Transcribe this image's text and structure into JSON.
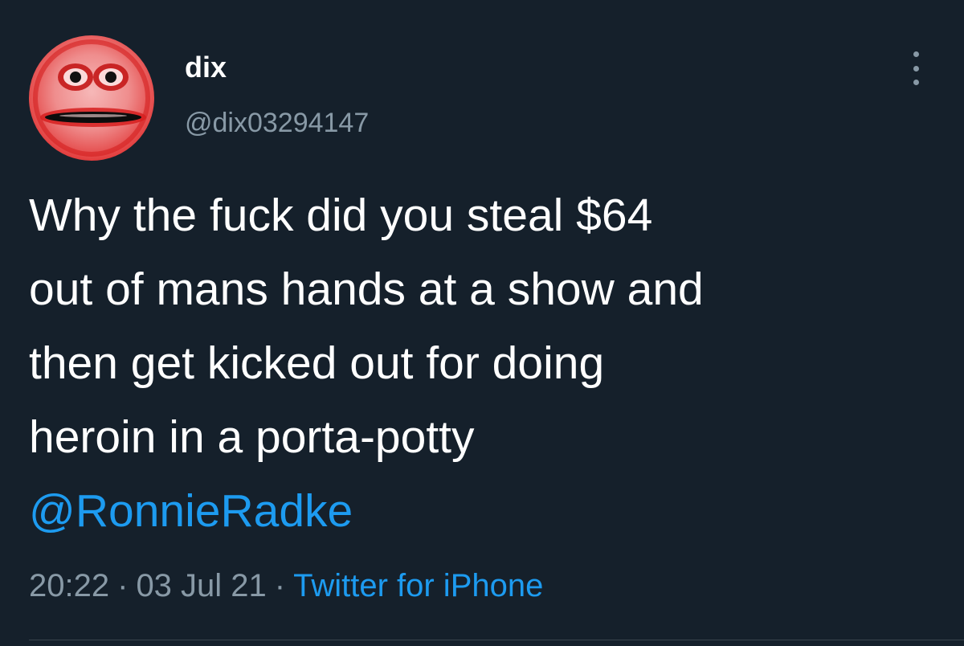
{
  "author": {
    "display_name": "dix",
    "handle": "@dix03294147",
    "avatar_icon": "distorted-face-avatar"
  },
  "tweet": {
    "lines": [
      "Why the fuck did you steal $64",
      "out of mans hands at a show and",
      "then get kicked out for doing",
      "heroin in a porta-potty"
    ],
    "mention": "@RonnieRadke"
  },
  "meta": {
    "time": "20:22",
    "separator": "·",
    "date": "03 Jul 21",
    "source": "Twitter for iPhone"
  },
  "menu": {
    "icon": "more-vertical-icon"
  },
  "colors": {
    "background": "#15202b",
    "text": "#ffffff",
    "secondary": "#8899a6",
    "link": "#1d9bf0"
  }
}
